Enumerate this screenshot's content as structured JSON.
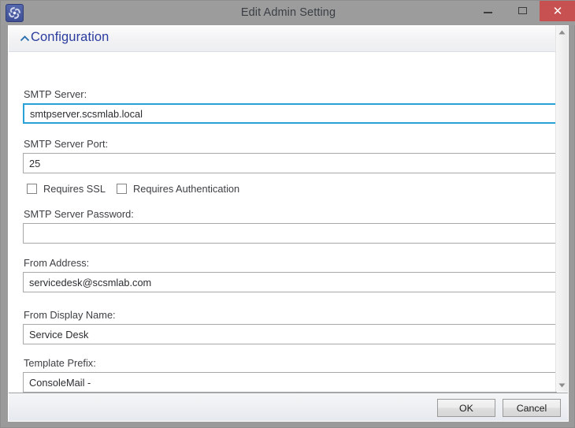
{
  "window": {
    "title": "Edit Admin Setting",
    "app_icon": "admin-setting-icon",
    "controls": {
      "minimize": "minimize-icon",
      "maximize": "maximize-icon",
      "close": "✕"
    },
    "close_button_color": "#c75050"
  },
  "section": {
    "title": "Configuration",
    "expander_icon": "chevron-up-icon",
    "expanded": true,
    "title_color": "#2a3c9e"
  },
  "form": {
    "fields": [
      {
        "label": "SMTP Server:",
        "value": "smtpserver.scsmlab.local",
        "placeholder": "",
        "focused": true
      },
      {
        "label": "SMTP Server Port:",
        "value": "25",
        "placeholder": "",
        "focused": false
      },
      {
        "label": "SMTP Server Password:",
        "value": "",
        "placeholder": "",
        "focused": false
      },
      {
        "label": "From Address:",
        "value": "servicedesk@scsmlab.com",
        "placeholder": "",
        "focused": false
      },
      {
        "label": "From Display Name:",
        "value": "Service Desk",
        "placeholder": "",
        "focused": false
      },
      {
        "label": "Template Prefix:",
        "value": "ConsoleMail -",
        "placeholder": "",
        "focused": false
      }
    ],
    "checkboxes": [
      {
        "label": "Requires SSL",
        "checked": false
      },
      {
        "label": "Requires Authentication",
        "checked": false
      }
    ]
  },
  "scrollbar": {
    "up_arrow": "scroll-up-icon",
    "down_arrow": "scroll-down-icon"
  },
  "footer": {
    "ok_label": "OK",
    "cancel_label": "Cancel"
  },
  "colors": {
    "focus_border": "#28a2d4",
    "titlebar": "#9c9c9c",
    "accent_link": "#2a3c9e"
  }
}
